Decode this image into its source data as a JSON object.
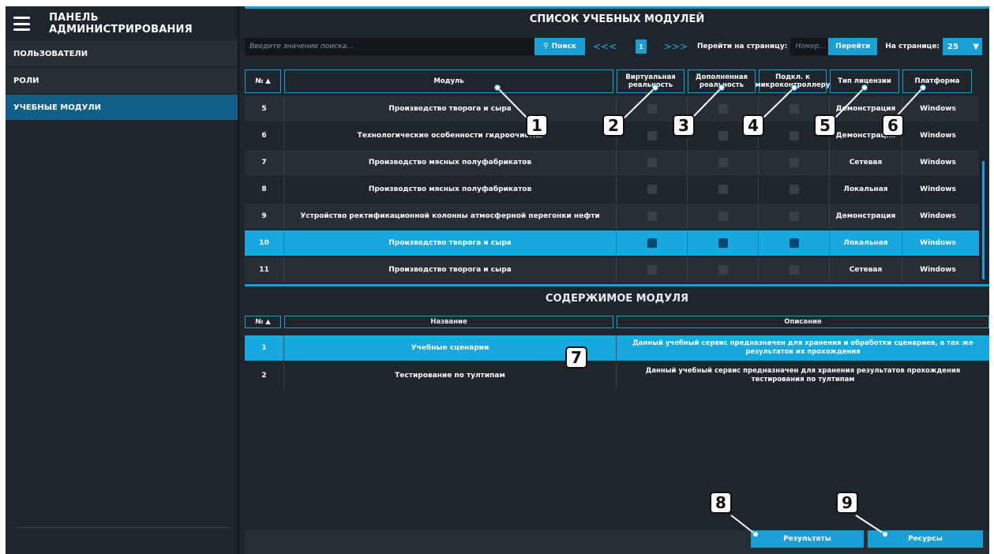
{
  "sidebar": {
    "title": "ПАНЕЛЬ АДМИНИСТРИРОВАНИЯ",
    "items": [
      {
        "label": "ПОЛЬЗОВАТЕЛИ"
      },
      {
        "label": "РОЛИ"
      },
      {
        "label": "УЧЕБНЫЕ МОДУЛИ"
      }
    ]
  },
  "modules": {
    "title": "СПИСОК УЧЕБНЫХ МОДУЛЕЙ",
    "search_placeholder": "Введите значение поиска...",
    "search_button": "Поиск",
    "pager": {
      "first": "<<",
      "prev": "<",
      "current": "1",
      "next": ">",
      "last": ">>"
    },
    "goto_label": "Перейти на страницу:",
    "goto_placeholder": "Номер...",
    "goto_button": "Перейти",
    "per_page_label": "На странице:",
    "per_page_value": "25",
    "columns": [
      "№ ▲",
      "Модуль",
      "Виртуальная реальность",
      "Дополненная реальность",
      "Подкл. к микроконтроллеру",
      "Тип лицензии",
      "Платформа"
    ],
    "rows": [
      {
        "num": "5",
        "name": "Производство творога и сыра",
        "license": "Демонстрация",
        "platform": "Windows"
      },
      {
        "num": "6",
        "name": "Технологические особенности гидроочистки",
        "license": "Демонстрация",
        "platform": "Windows"
      },
      {
        "num": "7",
        "name": "Производство мясных полуфабрикатов",
        "license": "Сетевая",
        "platform": "Windows"
      },
      {
        "num": "8",
        "name": "Производство мясных полуфабрикатов",
        "license": "Локальная",
        "platform": "Windows"
      },
      {
        "num": "9",
        "name": "Устройство ректификационной колонны атмосферной перегонки нефти",
        "license": "Демонстрация",
        "platform": "Windows"
      },
      {
        "num": "10",
        "name": "Производство творога и сыра",
        "license": "Локальная",
        "platform": "Windows"
      },
      {
        "num": "11",
        "name": "Производство творога и сыра",
        "license": "Сетевая",
        "platform": "Windows"
      }
    ],
    "selected_row": "10"
  },
  "content": {
    "title": "СОДЕРЖИМОЕ МОДУЛЯ",
    "columns": [
      "№ ▲",
      "Название",
      "Описание"
    ],
    "rows": [
      {
        "num": "1",
        "name": "Учебные сценарии",
        "desc": "Данный учебный сервис предназначен для хранения и обработки сценариев, а так же результатов их прохождения"
      },
      {
        "num": "2",
        "name": "Тестирование по тултипам",
        "desc": "Данный учебный сервис предназначен для хранения результатов прохождения тестирования по тултипам"
      }
    ]
  },
  "actions": {
    "results": "Результаты",
    "resources": "Ресурсы"
  },
  "callouts": [
    "1",
    "2",
    "3",
    "4",
    "5",
    "6",
    "7",
    "8",
    "9"
  ],
  "colors": {
    "accent": "#1a9fd4",
    "background": "#1f252c",
    "selected": "#16a8de"
  }
}
